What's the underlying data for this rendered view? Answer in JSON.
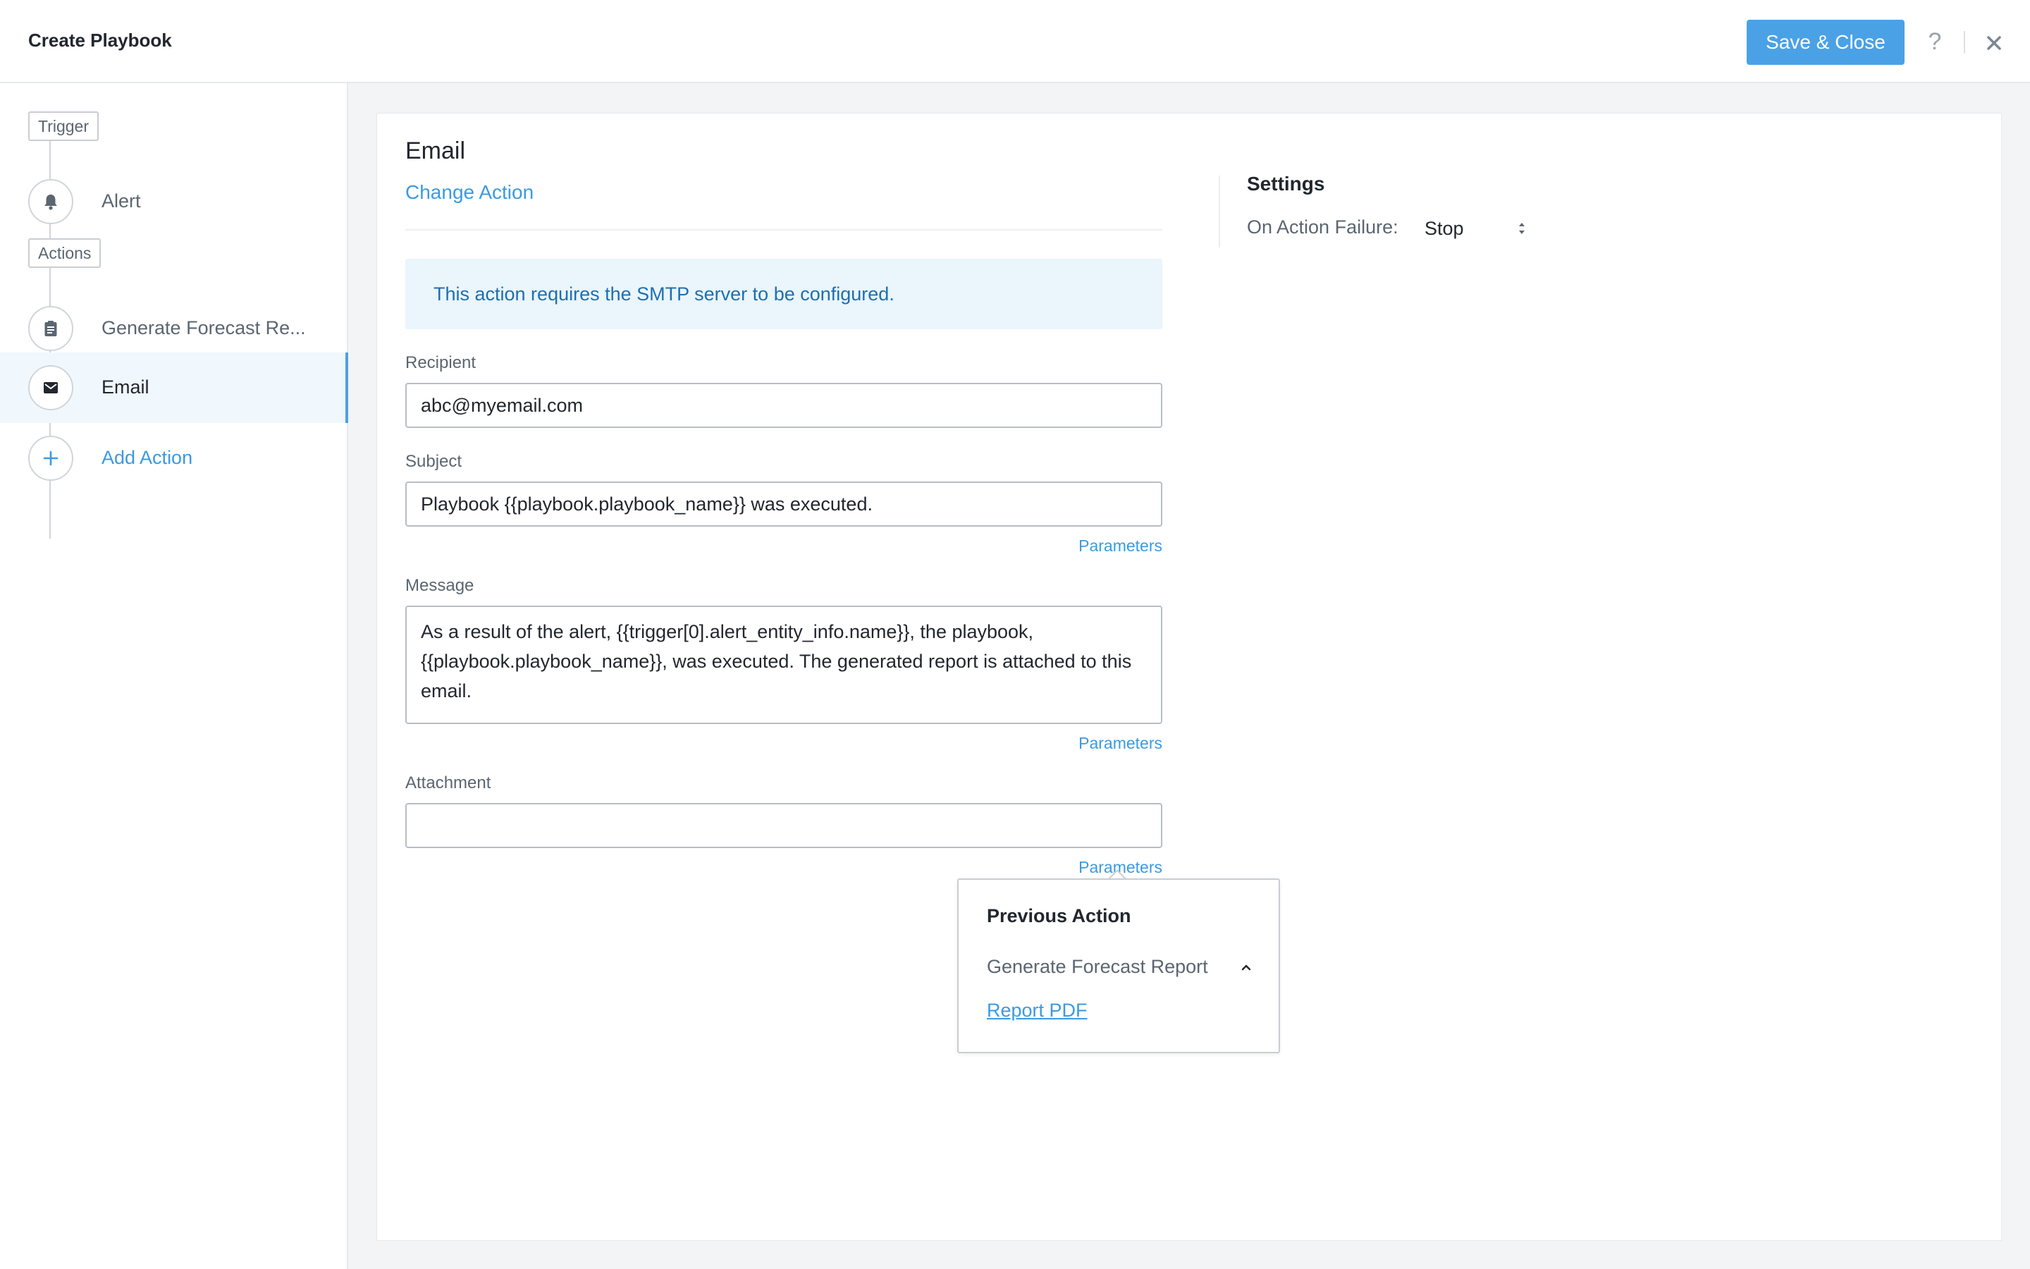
{
  "header": {
    "title": "Create Playbook",
    "save_label": "Save & Close",
    "help_label": "?"
  },
  "sidebar": {
    "trigger_tag": "Trigger",
    "actions_tag": "Actions",
    "steps": [
      {
        "label": "Alert",
        "icon": "bell-icon"
      },
      {
        "label": "Generate Forecast Re...",
        "icon": "report-icon"
      },
      {
        "label": "Email",
        "icon": "mail-icon",
        "active": true
      }
    ],
    "add_label": "Add Action"
  },
  "main": {
    "action_title": "Email",
    "change_action": "Change Action",
    "info": "This action requires the SMTP server to be configured.",
    "recipient_label": "Recipient",
    "recipient_value": "abc@myemail.com",
    "subject_label": "Subject",
    "subject_value": "Playbook {{playbook.playbook_name}} was executed.",
    "message_label": "Message",
    "message_value": "As a result of the alert, {{trigger[0].alert_entity_info.name}}, the playbook, {{playbook.playbook_name}}, was executed. The generated report is attached to this email.",
    "attachment_label": "Attachment",
    "attachment_value": "",
    "params_label": "Parameters"
  },
  "settings": {
    "title": "Settings",
    "failure_label": "On Action Failure:",
    "failure_value": "Stop"
  },
  "popover": {
    "title": "Previous Action",
    "group": "Generate Forecast Report",
    "item": "Report PDF"
  },
  "colors": {
    "accent": "#4ba1e6",
    "link": "#3b9ae1",
    "info_bg": "#eaf5fc"
  }
}
